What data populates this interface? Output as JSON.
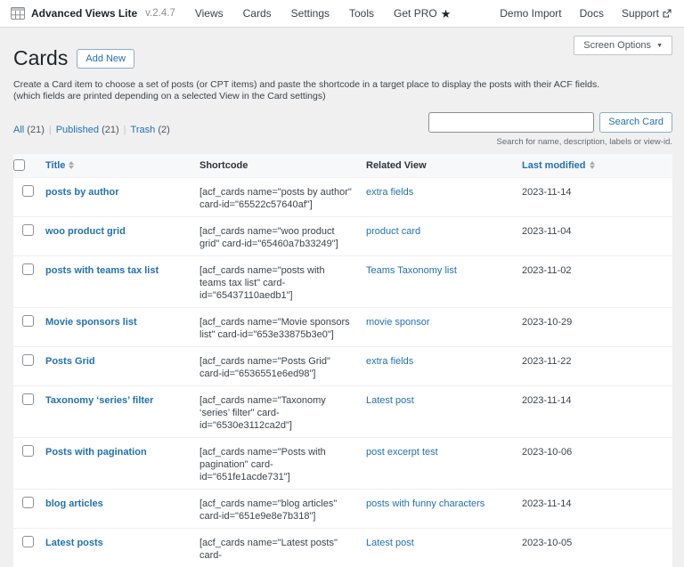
{
  "colors": {
    "accent": "#2271b1",
    "text_dark": "#1d2327",
    "page_bg": "#f0f0f1",
    "bar_bg": "#ffffff"
  },
  "topbar": {
    "plugin_name": "Advanced Views Lite",
    "version": "v.2.4.7",
    "nav": [
      "Views",
      "Cards",
      "Settings",
      "Tools",
      "Get PRO"
    ],
    "star": "★",
    "right_nav": [
      "Demo Import",
      "Docs",
      "Support"
    ]
  },
  "screen_options": {
    "label": "Screen Options",
    "caret": "▼"
  },
  "header": {
    "title": "Cards",
    "add_new": "Add New",
    "description_line1": "Create a Card item to choose a set of posts (or CPT items) and paste the shortcode in a target place to display the posts with their ACF fields.",
    "description_line2": "(which fields are printed depending on a selected View in the Card settings)"
  },
  "filters": [
    {
      "label": "All",
      "count": "(21)"
    },
    {
      "label": "Published",
      "count": "(21)"
    },
    {
      "label": "Trash",
      "count": "(2)"
    }
  ],
  "search": {
    "value": "",
    "button": "Search Card",
    "help": "Search for name, description, labels or view-id."
  },
  "table": {
    "columns": {
      "title": "Title",
      "shortcode": "Shortcode",
      "related_view": "Related View",
      "last_modified": "Last modified"
    },
    "rows": [
      {
        "title": "posts by author",
        "shortcode": "[acf_cards name=\"posts by author\" card-id=\"65522c57640af\"]",
        "related_view": "extra fields",
        "last_modified": "2023-11-14"
      },
      {
        "title": "woo product grid",
        "shortcode": "[acf_cards name=\"woo product grid\" card-id=\"65460a7b33249\"]",
        "related_view": "product card",
        "last_modified": "2023-11-04"
      },
      {
        "title": "posts with teams tax list",
        "shortcode": "[acf_cards name=\"posts with teams tax list\" card-id=\"65437110aedb1\"]",
        "related_view": "Teams Taxonomy list",
        "last_modified": "2023-11-02"
      },
      {
        "title": "Movie sponsors list",
        "shortcode": "[acf_cards name=\"Movie sponsors list\" card-id=\"653e33875b3e0\"]",
        "related_view": "movie sponsor",
        "last_modified": "2023-10-29"
      },
      {
        "title": "Posts Grid",
        "shortcode": "[acf_cards name=\"Posts Grid\" card-id=\"6536551e6ed98\"]",
        "related_view": "extra fields",
        "last_modified": "2023-11-22"
      },
      {
        "title": "Taxonomy ‘series’ filter",
        "shortcode": "[acf_cards name=\"Taxonomy ‘series’ filter\" card-id=\"6530e3112ca2d\"]",
        "related_view": "Latest post",
        "last_modified": "2023-11-14"
      },
      {
        "title": "Posts with pagination",
        "shortcode": "[acf_cards name=\"Posts with pagination\" card-id=\"651fe1acde731\"]",
        "related_view": "post excerpt test",
        "last_modified": "2023-10-06"
      },
      {
        "title": "blog articles",
        "shortcode": "[acf_cards name=\"blog articles\" card-id=\"651e9e8e7b318\"]",
        "related_view": "posts with funny characters",
        "last_modified": "2023-11-14"
      },
      {
        "title": "Latest posts",
        "shortcode": "[acf_cards name=\"Latest posts\" card-",
        "related_view": "Latest post",
        "last_modified": "2023-10-05"
      }
    ]
  }
}
